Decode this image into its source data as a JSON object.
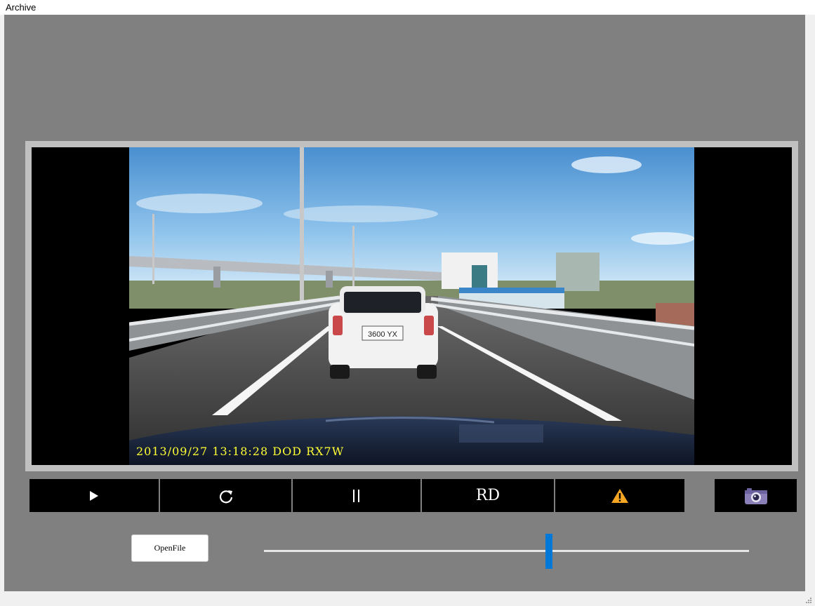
{
  "window": {
    "title": "Archive"
  },
  "video": {
    "timestamp_overlay": "2013/09/27 13:18:28 DOD RX7W",
    "plate_text": "3600 YX"
  },
  "controls": {
    "play_icon": "play-icon",
    "replay_icon": "refresh-icon",
    "pause_icon": "pause-icon",
    "rd_label": "RD",
    "warning_icon": "warning-icon",
    "snapshot_icon": "camera-icon"
  },
  "openfile": {
    "label": "OpenFile"
  },
  "seek": {
    "position_fraction": 0.587
  },
  "colors": {
    "client_bg": "#808080",
    "frame_bg": "#c0c0c0",
    "button_bg": "#000000",
    "slider_thumb": "#0078d7",
    "warning": "#f5a623",
    "osd_text": "#ffff33"
  }
}
